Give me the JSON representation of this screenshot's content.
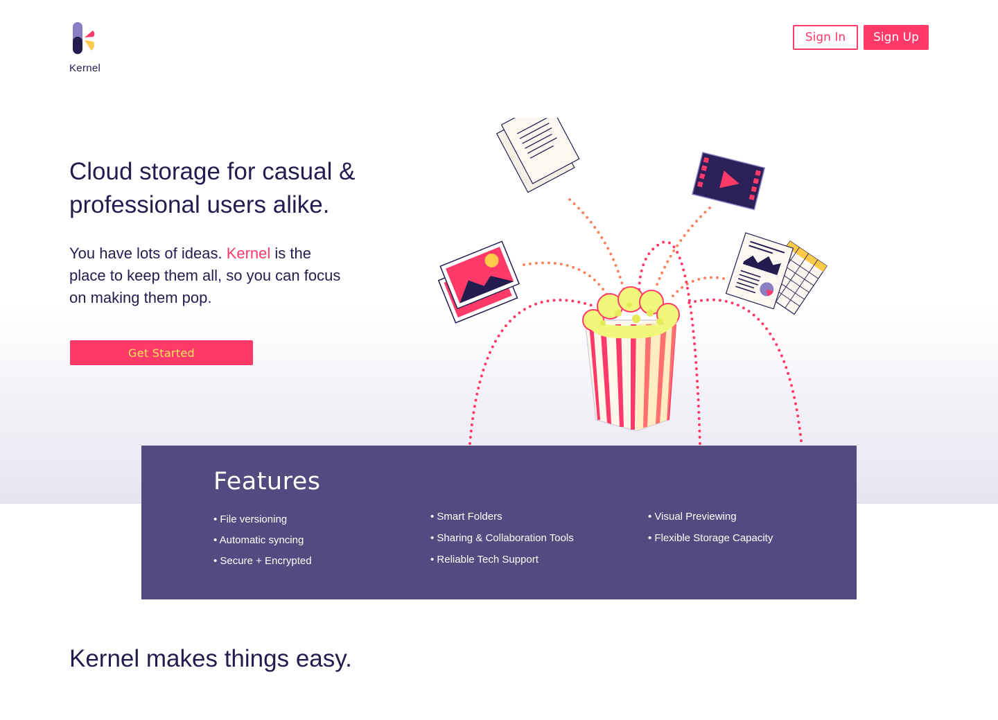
{
  "brand": {
    "name": "Kernel",
    "colors": {
      "primary": "#ff3968",
      "navy": "#231c4f",
      "purple": "#534b80",
      "yellow": "#ffe75a"
    }
  },
  "header": {
    "sign_in": "Sign In",
    "sign_up": "Sign Up"
  },
  "hero": {
    "title": "Cloud storage for casual & professional users alike.",
    "desc_before": "You have lots of ideas. ",
    "desc_accent": "Kernel",
    "desc_after": " is the place to keep them all, so you can focus on making them pop.",
    "cta": "Get Started",
    "illustration_icons": [
      "document-icon",
      "video-icon",
      "photo-icon",
      "report-icon",
      "spreadsheet-icon",
      "popcorn-icon"
    ]
  },
  "features": {
    "title": "Features",
    "columns": [
      [
        "File versioning",
        "Automatic syncing",
        "Secure + Encrypted"
      ],
      [
        "Smart Folders",
        "Sharing & Collaboration Tools",
        "Reliable Tech Support"
      ],
      [
        "Visual Previewing",
        "Flexible Storage Capacity"
      ]
    ]
  },
  "section2": {
    "title": "Kernel makes things easy."
  }
}
